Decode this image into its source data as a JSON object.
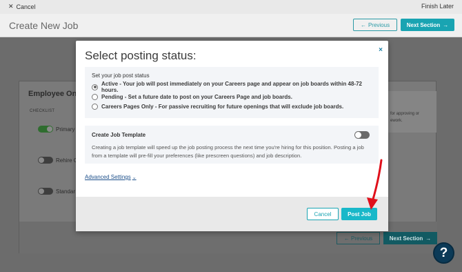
{
  "topbar": {
    "cancel_label": "Cancel",
    "finish_label": "Finish Later"
  },
  "header": {
    "title": "Create New Job",
    "previous_label": "Previous",
    "next_label": "Next Section"
  },
  "background_card": {
    "title": "Employee Onbo",
    "checklist_label": "CHECKLIST",
    "rows": [
      "Primary",
      "Rehire C",
      "Standar"
    ],
    "side_text_1": "for approving or",
    "side_text_2": "ework.",
    "footer_previous": "Previous",
    "footer_next": "Next Section"
  },
  "modal": {
    "title": "Select posting status:",
    "close_glyph": "×",
    "status_heading": "Set your job post status",
    "options": [
      {
        "label": "Active - Your job will post immediately on your Careers page and appear on job boards within 48-72 hours.",
        "selected": true
      },
      {
        "label": "Pending - Set a future date to post on your Careers Page and job boards.",
        "selected": false
      },
      {
        "label": "Careers Pages Only - For passive recruiting for future openings that will exclude job boards.",
        "selected": false
      }
    ],
    "template_heading": "Create Job Template",
    "template_toggle_on": false,
    "template_description": "Creating a job template will speed up the job posting process the next time you're hiring for this position. Posting a job from a template will pre-fill your preferences (like prescreen questions) and job description.",
    "advanced_label": "Advanced Settings",
    "cancel_label": "Cancel",
    "post_label": "Post Job"
  },
  "help": {
    "glyph": "?"
  },
  "colors": {
    "accent": "#19a4b2",
    "arrow": "#e0101b",
    "help": "#0c3a57"
  }
}
